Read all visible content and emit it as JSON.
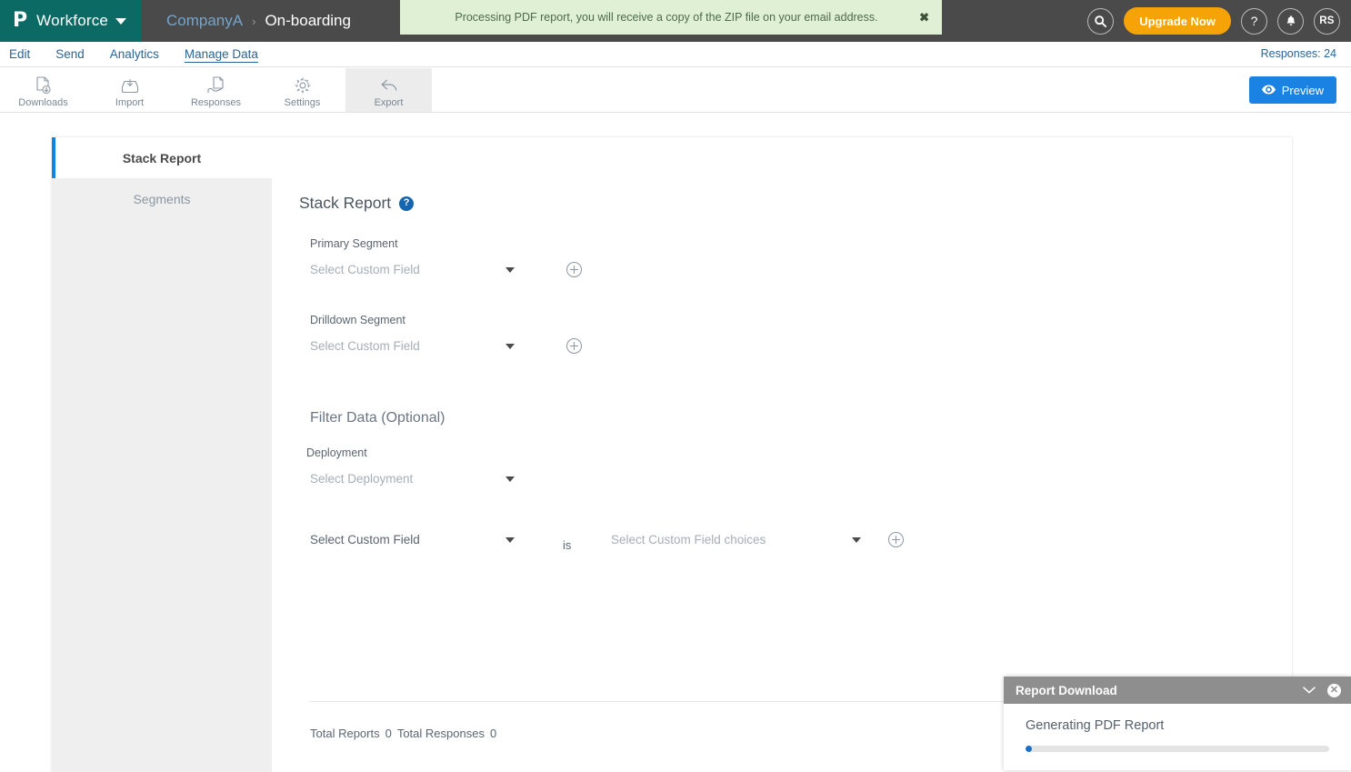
{
  "topbar": {
    "logo_glyph": "P",
    "brand": "Workforce",
    "breadcrumb": {
      "company": "CompanyA",
      "separator": "›",
      "current": "On-boarding"
    },
    "notice": {
      "text": "Processing PDF report, you will receive a copy of the ZIP file on your email address.",
      "close_label": "✖",
      "bg_color": "#dff0d5"
    },
    "search_icon": "search-icon",
    "upgrade_label": "Upgrade Now",
    "help_label": "?",
    "notification_icon": "bell-icon",
    "avatar_initials": "RS",
    "bar_color": "#4a4a4a",
    "brand_color": "#0b6a64",
    "upgrade_color": "#f5a306"
  },
  "nav": {
    "items": [
      {
        "label": "Edit",
        "active": false
      },
      {
        "label": "Send",
        "active": false
      },
      {
        "label": "Analytics",
        "active": false
      },
      {
        "label": "Manage Data",
        "active": true
      }
    ],
    "responses_label": "Responses: 24"
  },
  "toolbar": {
    "tools": [
      {
        "label": "Downloads",
        "icon": "file-download-icon",
        "active": false
      },
      {
        "label": "Import",
        "icon": "inbox-download-icon",
        "active": false
      },
      {
        "label": "Responses",
        "icon": "hand-document-icon",
        "active": false
      },
      {
        "label": "Settings",
        "icon": "gear-icon",
        "active": false
      },
      {
        "label": "Export",
        "icon": "reply-arrow-icon",
        "active": true
      }
    ],
    "preview_label": "Preview",
    "preview_icon": "eye-icon",
    "preview_color": "#1a82e2"
  },
  "sidebar": {
    "items": [
      {
        "label": "Stack Report",
        "active": true
      },
      {
        "label": "Segments",
        "active": false
      }
    ],
    "accent_color": "#0f84e0"
  },
  "main": {
    "title": "Stack Report",
    "help_icon": "help-circle-icon",
    "primary_segment": {
      "label": "Primary Segment",
      "placeholder": "Select Custom Field",
      "add_icon": "plus-circle-icon"
    },
    "drilldown_segment": {
      "label": "Drilldown Segment",
      "placeholder": "Select Custom Field",
      "add_icon": "plus-circle-icon"
    },
    "filter_section": {
      "heading": "Filter Data (Optional)",
      "deployment_label": "Deployment",
      "deployment_placeholder": "Select Deployment",
      "rule": {
        "field_value": "Select Custom Field",
        "operator": "is",
        "choices_placeholder": "Select Custom Field choices",
        "add_icon": "plus-circle-icon"
      }
    },
    "totals": {
      "reports_label": "Total Reports",
      "reports_value": "0",
      "responses_label": "Total Responses",
      "responses_value": "0"
    }
  },
  "report_download": {
    "title": "Report Download",
    "collapse_icon": "chevron-down-icon",
    "close_icon": "close-circle-icon",
    "status": "Generating PDF Report",
    "progress_percent": 2,
    "progress_color": "#1a6fc4",
    "header_color": "#8e8e8e"
  }
}
